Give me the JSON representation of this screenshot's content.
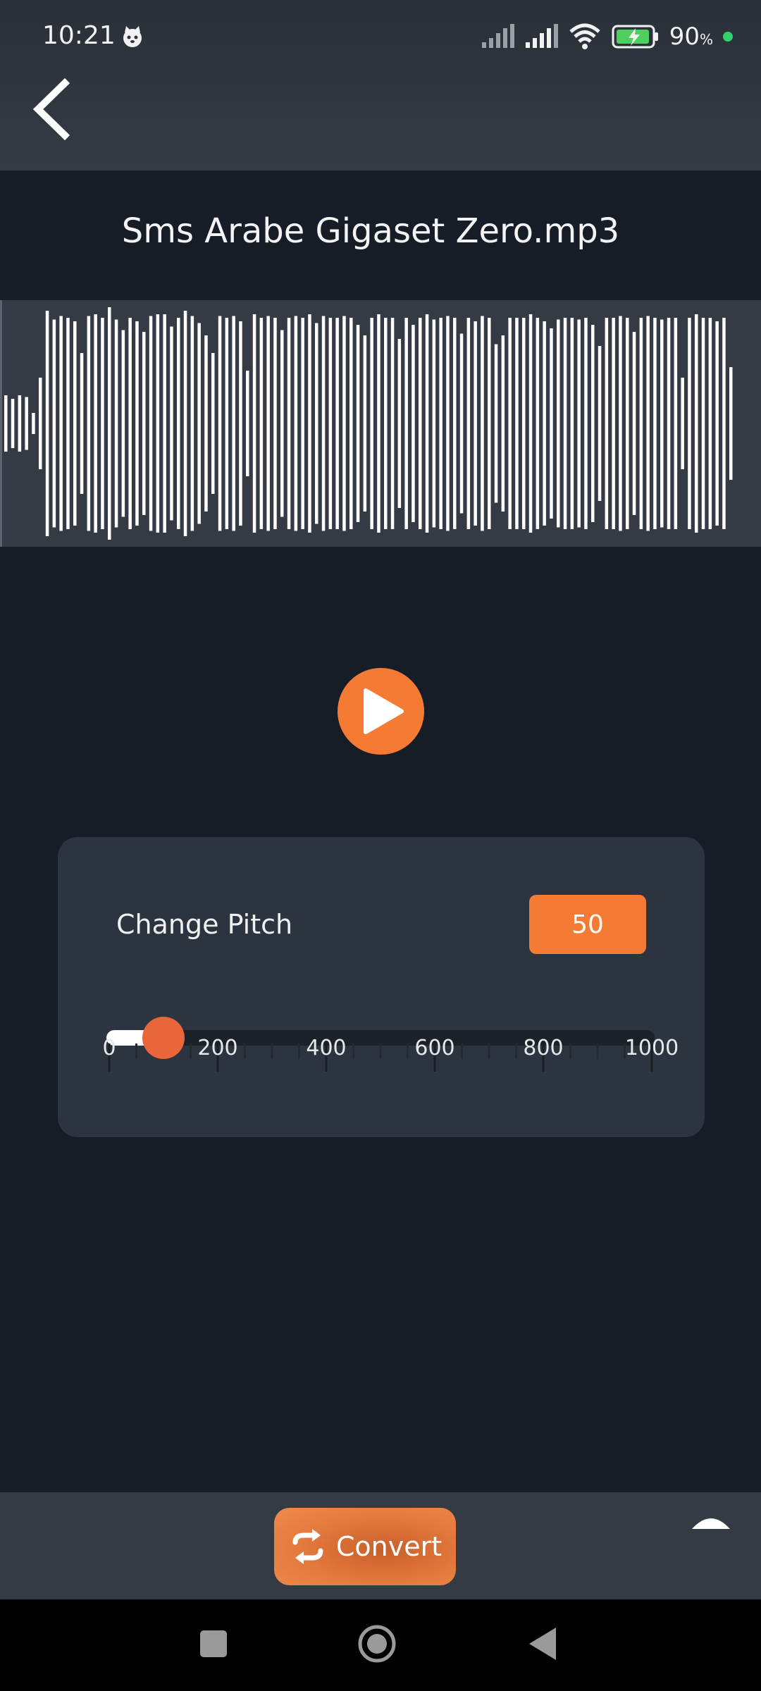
{
  "status_bar": {
    "time": "10:21",
    "battery_percent": "90",
    "battery_unit": "%",
    "icons": [
      "cat-notification-icon",
      "signal-icon",
      "signal-icon",
      "wifi-icon",
      "battery-charging-icon"
    ]
  },
  "app_bar": {
    "back_icon": "back-arrow-icon"
  },
  "file": {
    "title": "Sms Arabe Gigaset Zero.mp3"
  },
  "player": {
    "play_icon": "play-icon"
  },
  "pitch": {
    "label": "Change Pitch",
    "value": "50",
    "slider_value": 100,
    "slider_min": 0,
    "slider_max": 1000,
    "tick_labels": [
      "0",
      "200",
      "400",
      "600",
      "800",
      "1000"
    ]
  },
  "toolbar": {
    "convert_label": "Convert",
    "convert_icon": "swap-arrows-icon",
    "expand_icon": "chevron-up-icon"
  },
  "system_nav": {
    "icons": [
      "recents-icon",
      "home-icon",
      "back-icon"
    ]
  },
  "colors": {
    "accent": "#f57b34",
    "background": "#161d26",
    "card": "#2c343f",
    "waveform_bg": "#343b45"
  }
}
